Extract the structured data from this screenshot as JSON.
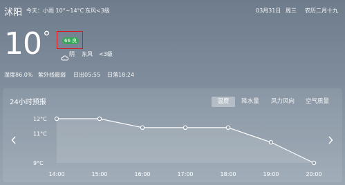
{
  "header": {
    "city": "沭阳",
    "today": "今天：小雨 10°~14°C",
    "wind": "东风<3级",
    "date": "03月31日",
    "weekday": "周三",
    "lunar": "农历二月十九"
  },
  "current": {
    "temperature": "10",
    "degree_symbol": "°",
    "aqi_label": "66 良",
    "condition": "阴",
    "wind_direction": "东风",
    "wind_level": "<3级",
    "condition_icon": "cloud-icon"
  },
  "details": {
    "humidity": "湿度86.0%",
    "uv": "紫外线最弱",
    "sunrise": "日出05:55",
    "sunset": "日落18:24"
  },
  "forecast": {
    "title": "24小时预报",
    "tabs": [
      "温度",
      "降水量",
      "风力风向",
      "空气质量"
    ],
    "active_tab": "温度",
    "prev_icon": "chevron-left-icon",
    "next_icon": "chevron-right-icon"
  },
  "colors": {
    "aqi_good": "#3aa65a",
    "highlight_box": "#d7191f"
  },
  "chart_data": {
    "type": "area",
    "categories": [
      "14:00",
      "15:00",
      "16:00",
      "17:00",
      "18:00",
      "19:00",
      "20:00"
    ],
    "values": [
      12,
      12,
      11.4,
      11.4,
      11.4,
      10.4,
      9
    ],
    "y_ticks": [
      "12°C",
      "11°C",
      "9°C"
    ],
    "ylim": [
      9,
      12
    ],
    "grid": false
  }
}
